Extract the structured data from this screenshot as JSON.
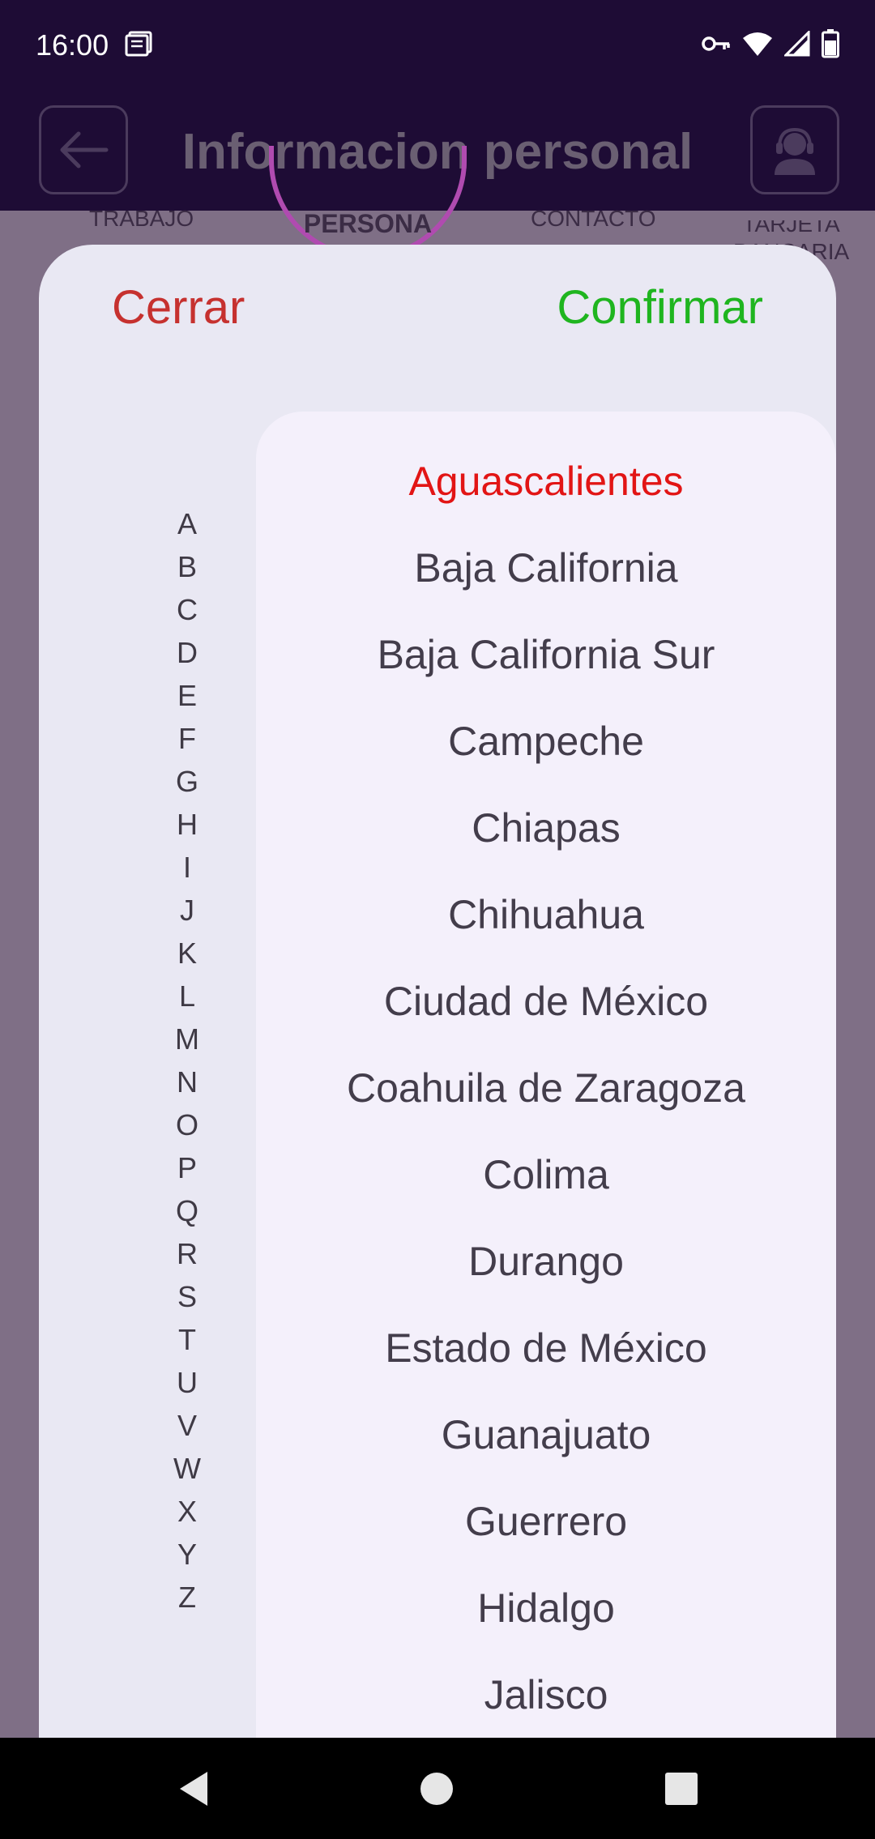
{
  "status": {
    "time": "16:00"
  },
  "app_bar": {
    "title": "Informacion personal"
  },
  "steps": {
    "trabajo": "TRABAJO",
    "persona": "PERSONA",
    "contacto": "CONTACTO",
    "bancaria_line1": "TARJETA",
    "bancaria_line2": "BANCARIA"
  },
  "sheet": {
    "close_label": "Cerrar",
    "confirm_label": "Confirmar"
  },
  "alphabet": [
    "A",
    "B",
    "C",
    "D",
    "E",
    "F",
    "G",
    "H",
    "I",
    "J",
    "K",
    "L",
    "M",
    "N",
    "O",
    "P",
    "Q",
    "R",
    "S",
    "T",
    "U",
    "V",
    "W",
    "X",
    "Y",
    "Z"
  ],
  "states": [
    "Aguascalientes",
    "Baja California",
    "Baja California Sur",
    "Campeche",
    "Chiapas",
    "Chihuahua",
    "Ciudad de México",
    "Coahuila de Zaragoza",
    "Colima",
    "Durango",
    "Estado de México",
    "Guanajuato",
    "Guerrero",
    "Hidalgo",
    "Jalisco"
  ],
  "selected_state": "Aguascalientes",
  "colors": {
    "cancel": "#c6312f",
    "confirm": "#1fb51f",
    "selected": "#e21515"
  }
}
